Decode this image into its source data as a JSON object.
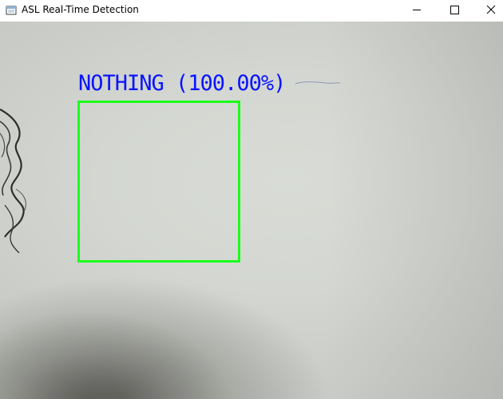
{
  "window": {
    "title": "ASL Real-Time Detection",
    "controls": [
      "minimize-icon",
      "maximize-icon",
      "close-icon"
    ]
  },
  "detection": {
    "label": "NOTHING (100.00%)",
    "label_color": "#0a14ff",
    "box_color": "#1aff1a"
  }
}
